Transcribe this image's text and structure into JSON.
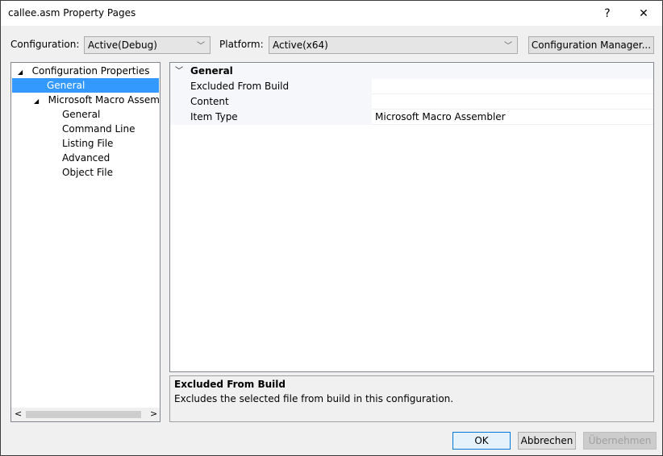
{
  "window": {
    "title": "callee.asm Property Pages",
    "help_label": "?",
    "close_label": "✕"
  },
  "toolbar": {
    "configuration_label": "Configuration:",
    "configuration_value": "Active(Debug)",
    "platform_label": "Platform:",
    "platform_value": "Active(x64)",
    "config_manager_label": "Configuration Manager..."
  },
  "tree": {
    "items": [
      {
        "label": "Configuration Properties",
        "expander": "◢"
      },
      {
        "label": "General",
        "selected": true
      },
      {
        "label": "Microsoft Macro Assembler",
        "expander": "◢"
      },
      {
        "label": "General"
      },
      {
        "label": "Command Line"
      },
      {
        "label": "Listing File"
      },
      {
        "label": "Advanced"
      },
      {
        "label": "Object File"
      }
    ],
    "scroll_left": "<",
    "scroll_right": ">"
  },
  "grid": {
    "category": "General",
    "rows": [
      {
        "name": "Excluded From Build",
        "value": ""
      },
      {
        "name": "Content",
        "value": ""
      },
      {
        "name": "Item Type",
        "value": "Microsoft Macro Assembler"
      }
    ]
  },
  "description": {
    "title": "Excluded From Build",
    "text": "Excludes the selected file from build in this configuration."
  },
  "buttons": {
    "ok": "OK",
    "cancel": "Abbrechen",
    "apply": "Übernehmen"
  },
  "colors": {
    "selection": "#3399ff",
    "ok_border": "#0078d7"
  }
}
